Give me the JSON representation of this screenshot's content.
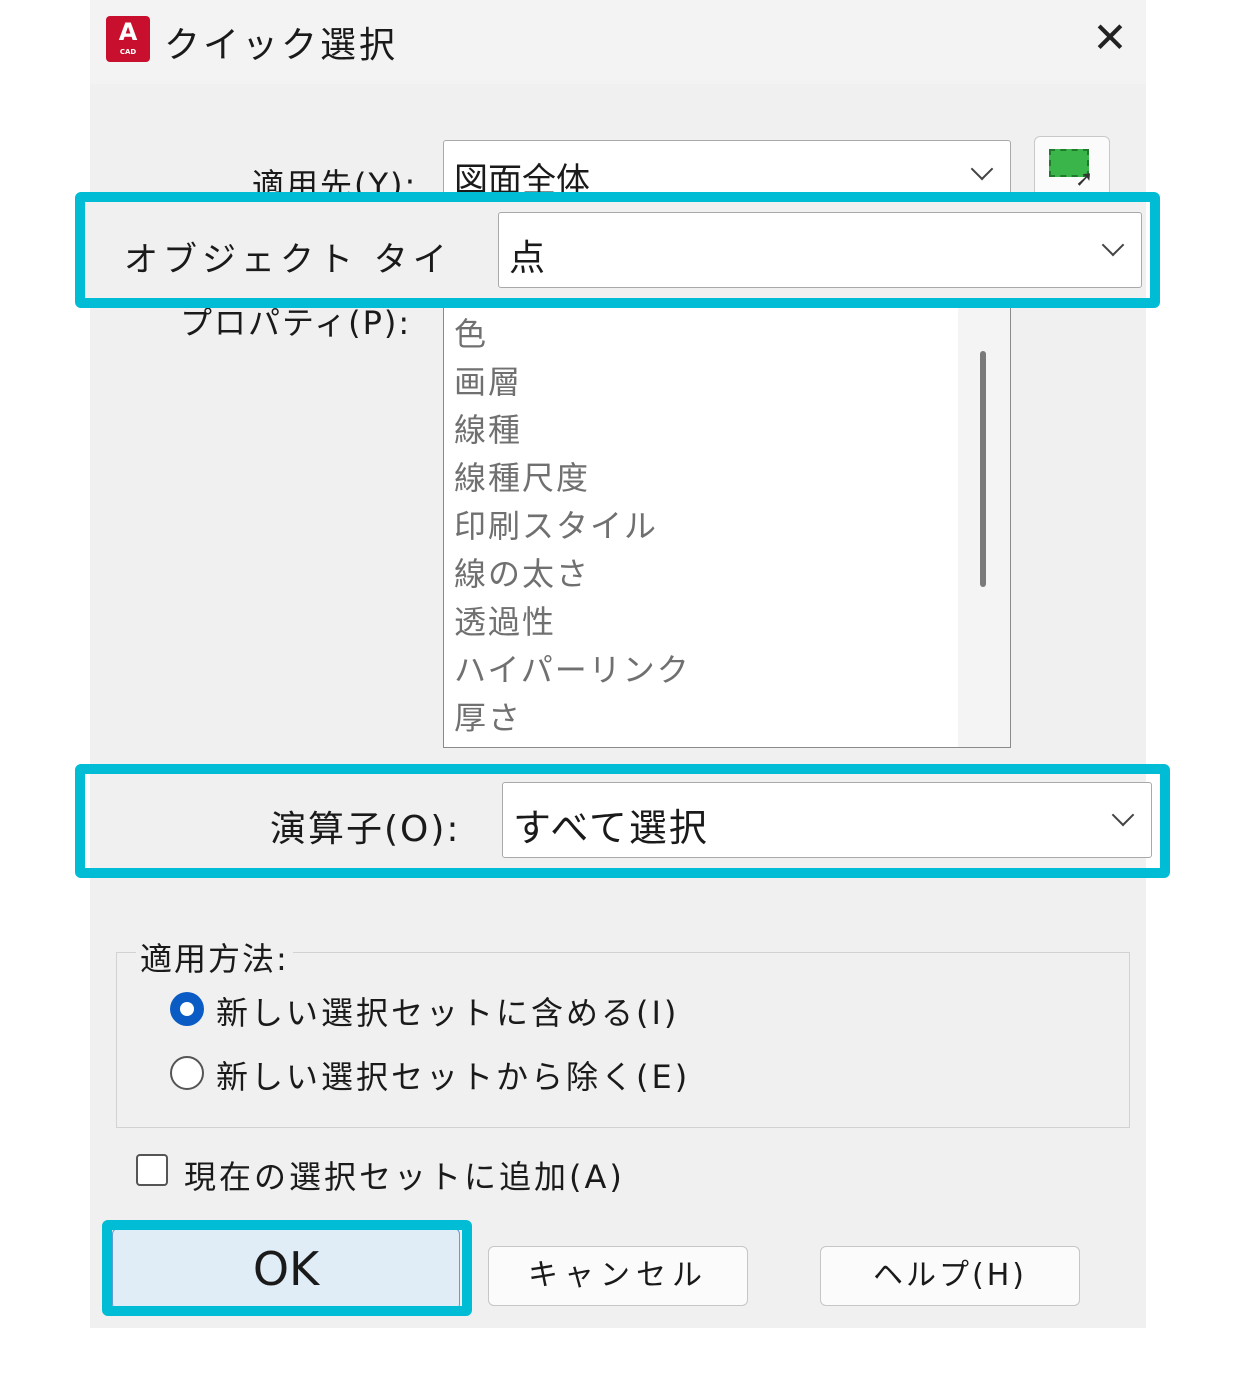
{
  "window": {
    "title": "クイック選択",
    "app_icon_letter": "A",
    "app_icon_caption": "CAD",
    "close_glyph": "✕"
  },
  "form": {
    "apply_to": {
      "label": "適用先(Y):",
      "value": "図面全体"
    },
    "object_type": {
      "label": "オブジェクト タイ",
      "value": "点"
    },
    "properties": {
      "label": "プロパティ(P):",
      "items": [
        "色",
        "画層",
        "線種",
        "線種尺度",
        "印刷スタイル",
        "線の太さ",
        "透過性",
        "ハイパーリンク",
        "厚さ"
      ]
    },
    "operator": {
      "label": "演算子(O):",
      "value": "すべて選択"
    },
    "apply_method": {
      "title": "適用方法:",
      "options": [
        {
          "label": "新しい選択セットに含める(I)",
          "selected": true
        },
        {
          "label": "新しい選択セットから除く(E)",
          "selected": false
        }
      ]
    },
    "append_checkbox": {
      "label": "現在の選択セットに追加(A)",
      "checked": false
    }
  },
  "buttons": {
    "ok": "OK",
    "cancel": "キャンセル",
    "help": "ヘルプ(H)"
  },
  "colors": {
    "highlight": "#00bcd4",
    "radio_selected": "#0a5bc4",
    "app_icon": "#c8102e"
  }
}
